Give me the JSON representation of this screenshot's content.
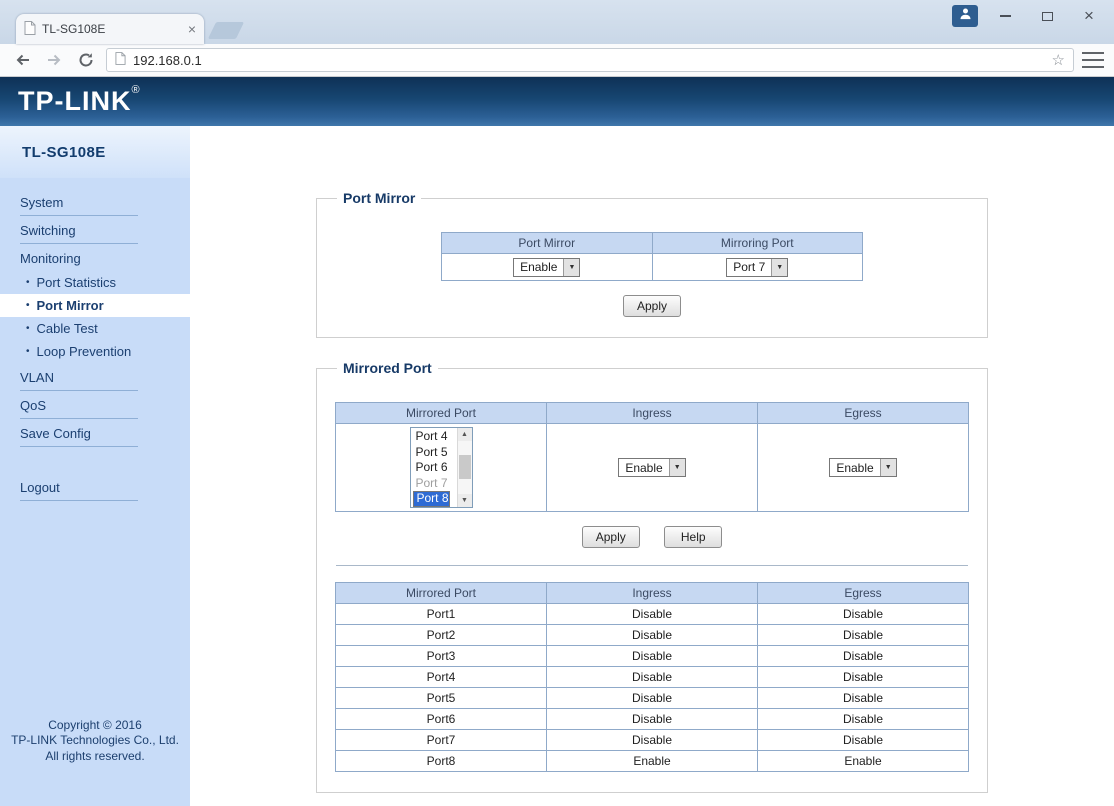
{
  "icons": {
    "close": "×",
    "star": "☆",
    "bullet": "•",
    "chevron_down": "▼",
    "arrow_up": "▲",
    "arrow_down": "▼"
  },
  "browser": {
    "tab_title": "TL-SG108E",
    "url": "192.168.0.1"
  },
  "banner": {
    "logo": "TP-LINK",
    "reg": "®"
  },
  "sidebar": {
    "model": "TL-SG108E",
    "items": [
      {
        "label": "System"
      },
      {
        "label": "Switching"
      },
      {
        "label": "Monitoring"
      },
      {
        "label": "Port Statistics"
      },
      {
        "label": "Port Mirror"
      },
      {
        "label": "Cable Test"
      },
      {
        "label": "Loop Prevention"
      },
      {
        "label": "VLAN"
      },
      {
        "label": "QoS"
      },
      {
        "label": "Save Config"
      },
      {
        "label": "Logout"
      }
    ],
    "copyright": {
      "line1": "Copyright © 2016",
      "line2": "TP-LINK Technologies Co., Ltd.",
      "line3": "All rights reserved."
    }
  },
  "port_mirror": {
    "legend": "Port Mirror",
    "headers": [
      "Port Mirror",
      "Mirroring Port"
    ],
    "mirror_value": "Enable",
    "mirroring_port_value": "Port 7",
    "apply": "Apply"
  },
  "mirrored": {
    "legend": "Mirrored Port",
    "config": {
      "headers": [
        "Mirrored Port",
        "Ingress",
        "Egress"
      ],
      "options": [
        {
          "label": "Port 4",
          "state": "normal"
        },
        {
          "label": "Port 5",
          "state": "normal"
        },
        {
          "label": "Port 6",
          "state": "normal"
        },
        {
          "label": "Port 7",
          "state": "disabled"
        },
        {
          "label": "Port 8",
          "state": "selected"
        }
      ],
      "ingress": "Enable",
      "egress": "Enable"
    },
    "apply": "Apply",
    "help": "Help",
    "status": {
      "headers": [
        "Mirrored Port",
        "Ingress",
        "Egress"
      ],
      "rows": [
        {
          "port": "Port1",
          "ingress": "Disable",
          "egress": "Disable"
        },
        {
          "port": "Port2",
          "ingress": "Disable",
          "egress": "Disable"
        },
        {
          "port": "Port3",
          "ingress": "Disable",
          "egress": "Disable"
        },
        {
          "port": "Port4",
          "ingress": "Disable",
          "egress": "Disable"
        },
        {
          "port": "Port5",
          "ingress": "Disable",
          "egress": "Disable"
        },
        {
          "port": "Port6",
          "ingress": "Disable",
          "egress": "Disable"
        },
        {
          "port": "Port7",
          "ingress": "Disable",
          "egress": "Disable"
        },
        {
          "port": "Port8",
          "ingress": "Enable",
          "egress": "Enable"
        }
      ]
    }
  }
}
